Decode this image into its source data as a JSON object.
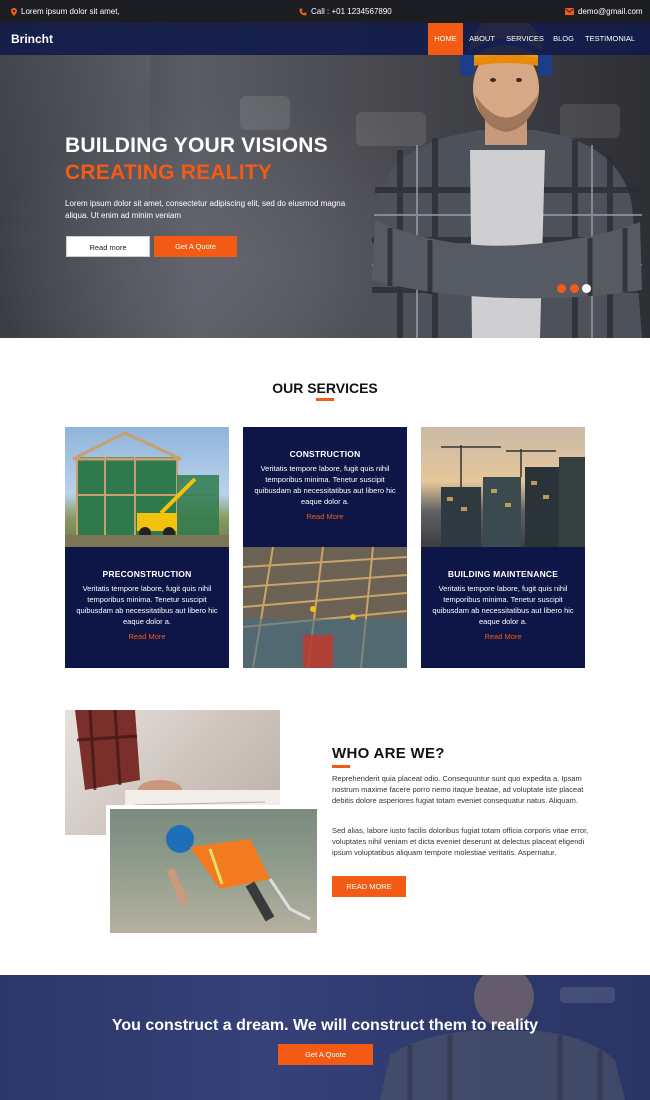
{
  "topbar": {
    "address": "Lorem ipsum dolor sit amet,",
    "call": "Call : +01 1234567890",
    "email": "demo@gmail.com"
  },
  "nav": {
    "brand": "Brincht",
    "items": [
      "HOME",
      "ABOUT",
      "SERVICES",
      "BLOG",
      "TESTIMONIAL"
    ],
    "active": "HOME"
  },
  "hero": {
    "title_line1": "BUILDING YOUR VISIONS",
    "title_line2": "CREATING REALITY",
    "subtitle": "Lorem ipsum dolor sit amet, consectetur adipiscing elit, sed do eiusmod magna aliqua. Ut enim ad minim veniam",
    "btn_read_more": "Read more",
    "btn_quote": "Get A Quote",
    "slides": 3,
    "active_slide": 3
  },
  "services": {
    "title": "OUR SERVICES",
    "cards": [
      {
        "title": "PRECONSTRUCTION",
        "text": "Veritatis tempore labore, fugit quis nihil temporibus minima. Tenetur suscipit quibusdam ab necessitatibus aut libero hic eaque dolor a.",
        "link": "Read More"
      },
      {
        "title": "CONSTRUCTION",
        "text": "Veritatis tempore labore, fugit quis nihil temporibus minima. Tenetur suscipit quibusdam ab necessitatibus aut libero hic eaque dolor a.",
        "link": "Read More"
      },
      {
        "title": "BUILDING MAINTENANCE",
        "text": "Veritatis tempore labore, fugit quis nihil temporibus minima. Tenetur suscipit quibusdam ab necessitatibus aut libero hic eaque dolor a.",
        "link": "Read More"
      }
    ]
  },
  "who": {
    "title": "WHO ARE WE?",
    "p1": "Reprehenderit quia placeat odio. Consequuntur sunt quo expedita a. Ipsam nostrum maxime facere porro nemo itaque beatae, ad voluptate iste placeat debitis dolore asperiores fugiat totam eveniet consequatur natus. Aliquam.",
    "p2": "Sed alias, labore iusto facilis doloribus fugiat totam officia corporis vitae error, voluptates nihil veniam et dicta eveniet deserunt at delectus placeat eligendi ipsum voluptatibus aliquam tempore molestiae veritatis. Aspernatur.",
    "btn": "READ MORE"
  },
  "cta": {
    "title": "You construct a dream. We will construct them to reality",
    "btn": "Get A Quote"
  },
  "colors": {
    "accent": "#f35b14",
    "navy": "#0e1647",
    "nav_bg": "#111c4a",
    "topbar_bg": "#1c1d22"
  }
}
